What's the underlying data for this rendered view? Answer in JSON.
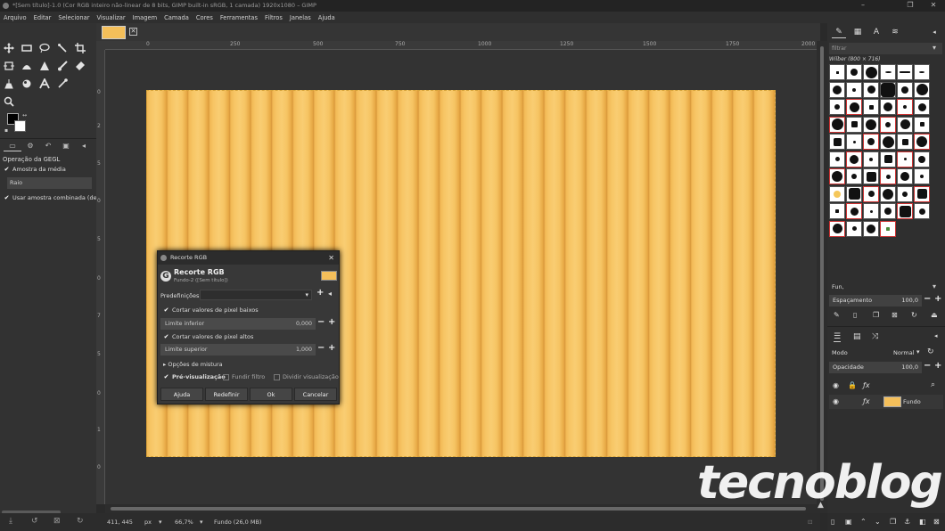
{
  "window": {
    "title": "*[Sem título]-1.0 (Cor RGB inteiro não-linear de 8 bits, GIMP built-in sRGB, 1 camada) 1920x1080 – GIMP",
    "minimize": "–",
    "maximize": "❐",
    "close": "✕"
  },
  "menu": [
    "Arquivo",
    "Editar",
    "Selecionar",
    "Visualizar",
    "Imagem",
    "Camada",
    "Cores",
    "Ferramentas",
    "Filtros",
    "Janelas",
    "Ajuda"
  ],
  "toolbox": {
    "tools": [
      "move-tool",
      "rect-select-tool",
      "lasso-tool",
      "fuzzy-select-tool",
      "crop-tool",
      "unified-transform-tool",
      "warp-tool",
      "paint-select-tool",
      "paintbrush-tool",
      "eraser-tool",
      "clone-tool",
      "smudge-tool",
      "text-tool",
      "color-picker-tool",
      "zoom-tool"
    ],
    "options_title": "Operação da GEGL",
    "option_sample_average": "Amostra da média",
    "radius_label": "Raio",
    "option_sample_merged": "Usar amostra combinada (de"
  },
  "ruler": {
    "h": [
      "0",
      "250",
      "500",
      "750",
      "1000",
      "1250",
      "1500",
      "1750",
      "2000"
    ],
    "v": [
      "0",
      "2",
      "5",
      "0",
      "5",
      "0",
      "7",
      "5",
      "0",
      "1",
      "0"
    ]
  },
  "dialog": {
    "window_title": "Recorte RGB",
    "name": "Recorte RGB",
    "subtitle": "Fundo-2 ([Sem título])",
    "presets_label": "Predefinições:",
    "clip_low_label": "Cortar valores de pixel baixos",
    "low_limit_label": "Limite inferior",
    "low_limit_value": "0,000",
    "clip_high_label": "Cortar valores de pixel altos",
    "high_limit_label": "Limite superior",
    "high_limit_value": "1,000",
    "blend_options": "Opções de mistura",
    "preview": "Pré-visualização",
    "merge_filter": "Fundir filtro",
    "split_view": "Dividir visualização",
    "btn_help": "Ajuda",
    "btn_reset": "Redefinir",
    "btn_ok": "Ok",
    "btn_cancel": "Cancelar"
  },
  "status": {
    "coords": "411, 445",
    "unit": "px",
    "zoom": "66,7%",
    "layer_info": "Fundo (26,0 MB)"
  },
  "right_panel": {
    "filter_placeholder": "filtrar",
    "brush_name": "Wilber (800 × 716)",
    "brush_tag": "Fun,",
    "spacing_label": "Espaçamento",
    "spacing_value": "100,0",
    "mode_label": "Modo",
    "mode_value": "Normal",
    "opacity_label": "Opacidade",
    "opacity_value": "100,0",
    "layer_name": "Fundo"
  },
  "colors": {
    "image_fill": "#f4bf5a",
    "canvas_bg": "#333333"
  },
  "watermark": "tecnoblog"
}
